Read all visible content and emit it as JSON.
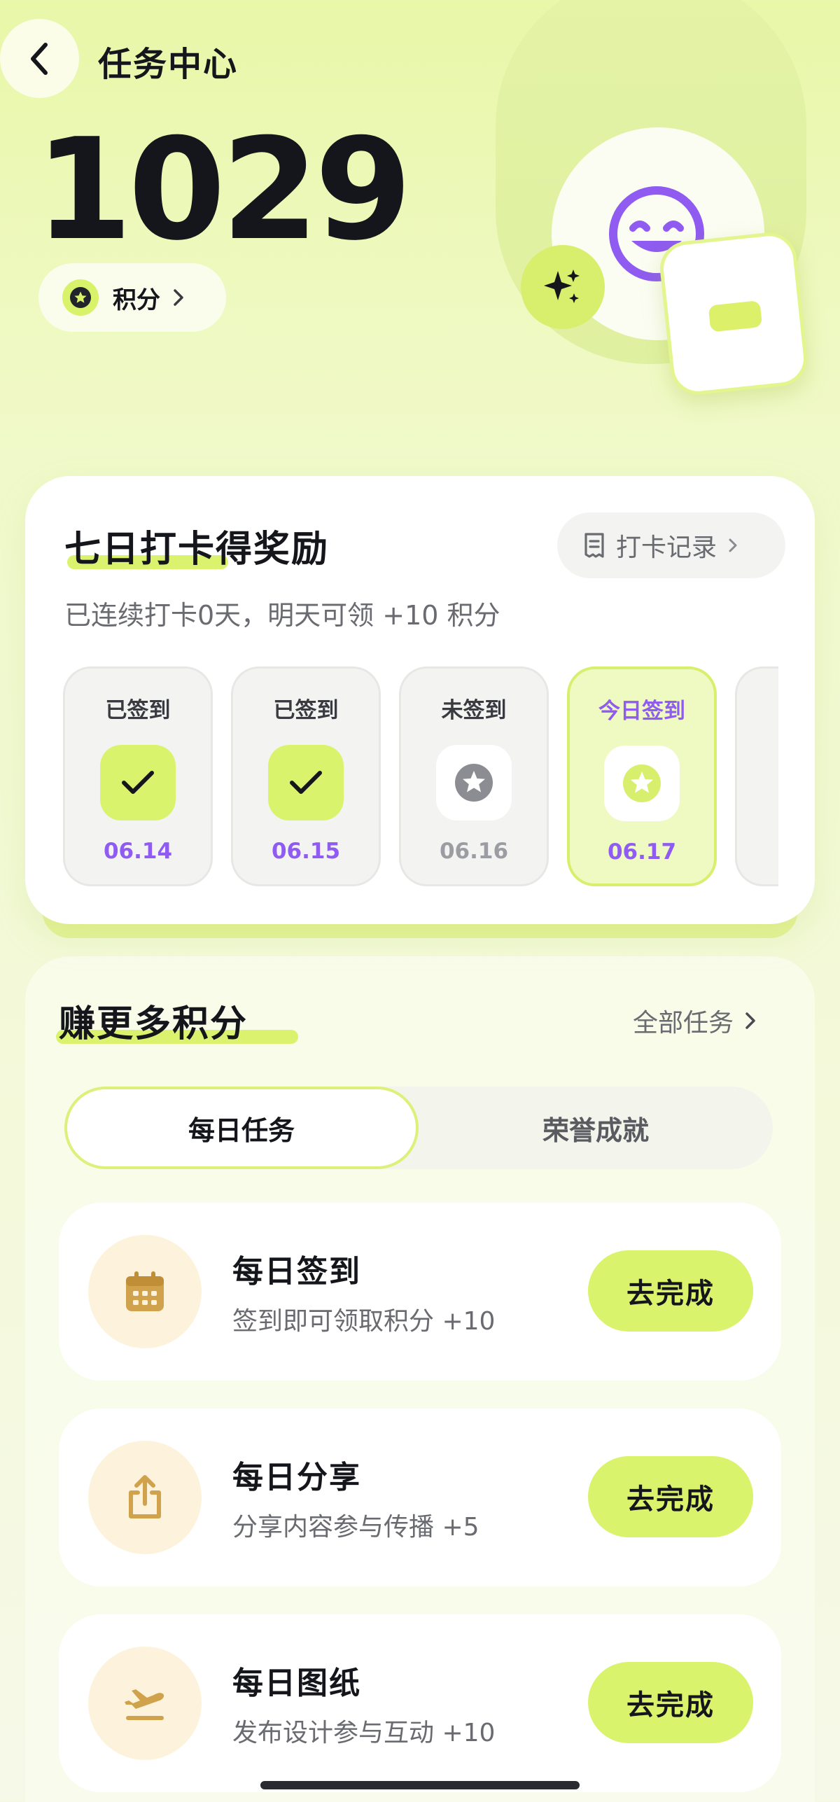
{
  "header": {
    "title": "任务中心",
    "points": "1029",
    "points_label": "积分"
  },
  "checkin": {
    "title": "七日打卡得奖励",
    "record_label": "打卡记录",
    "subtitle": "已连续打卡0天，明天可领 +10 积分",
    "days": [
      {
        "status": "已签到",
        "date": "06.14",
        "state": "done",
        "icon": "check-icon"
      },
      {
        "status": "已签到",
        "date": "06.15",
        "state": "done",
        "icon": "check-icon"
      },
      {
        "status": "未签到",
        "date": "06.16",
        "state": "missed",
        "icon": "star-badge-icon"
      },
      {
        "status": "今日签到",
        "date": "06.17",
        "state": "today",
        "icon": "star-badge-icon"
      }
    ]
  },
  "earn": {
    "title": "赚更多积分",
    "all_tasks": "全部任务",
    "tabs": [
      {
        "label": "每日任务",
        "active": true
      },
      {
        "label": "荣誉成就",
        "active": false
      }
    ],
    "tasks": [
      {
        "name": "每日签到",
        "desc": "签到即可领取积分 +10",
        "action": "去完成",
        "icon": "calendar-icon"
      },
      {
        "name": "每日分享",
        "desc": "分享内容参与传播 +5",
        "action": "去完成",
        "icon": "share-icon"
      },
      {
        "name": "每日图纸",
        "desc": "发布设计参与互动 +10",
        "action": "去完成",
        "icon": "plane-takeoff-icon"
      }
    ]
  },
  "colors": {
    "accent": "#d9f36d",
    "purple": "#8f5bf0",
    "icon_brown": "#d1a24c",
    "text": "#15161c"
  }
}
